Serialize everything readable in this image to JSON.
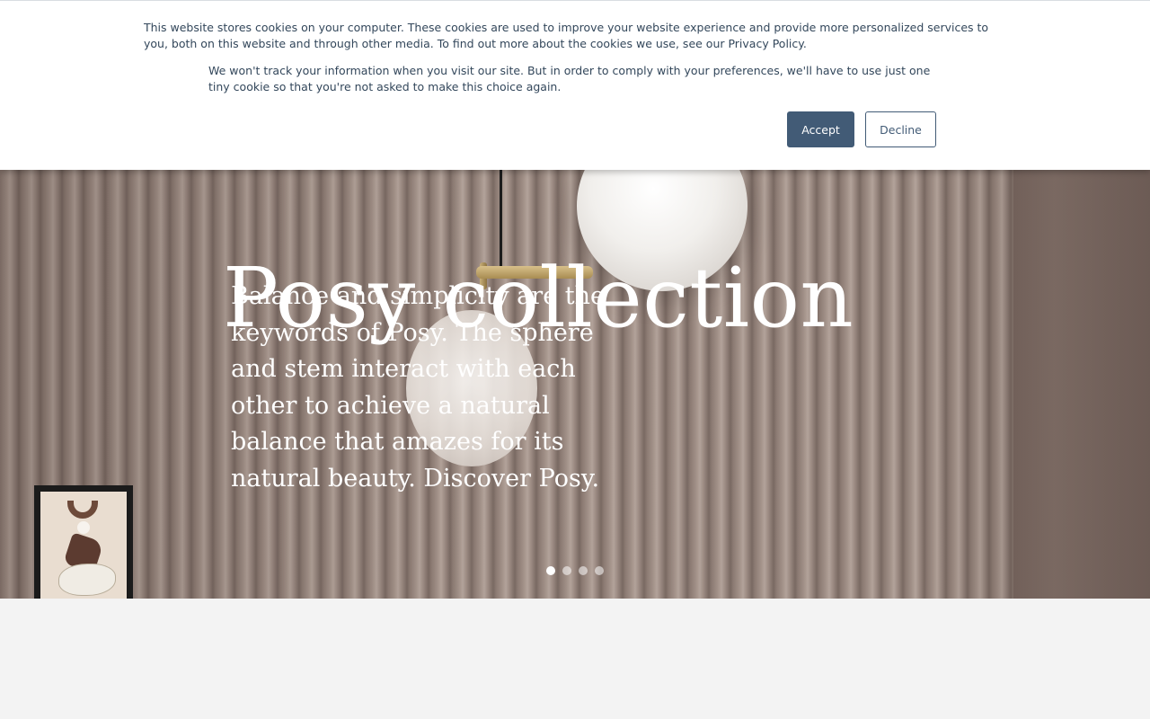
{
  "cookie_banner": {
    "message": "This website stores cookies on your computer. These cookies are used to improve your website experience and provide more personalized services to you, both on this website and through other media. To find out more about the cookies we use, see our Privacy Policy.",
    "decline_notice": "We won't track your information when you visit our site. But in order to comply with your preferences, we'll have to use just one tiny cookie so that you're not asked to make this choice again.",
    "accept_label": "Accept",
    "decline_label": "Decline",
    "accent_color": "#425b76"
  },
  "hero": {
    "title": "Posy collection",
    "description": "Balance and simplicity are the keywords of Posy. The sphere and stem interact with each other to achieve a natural balance that amazes for its natural beauty. Discover Posy.",
    "slides_total": 4,
    "active_slide": 1
  }
}
